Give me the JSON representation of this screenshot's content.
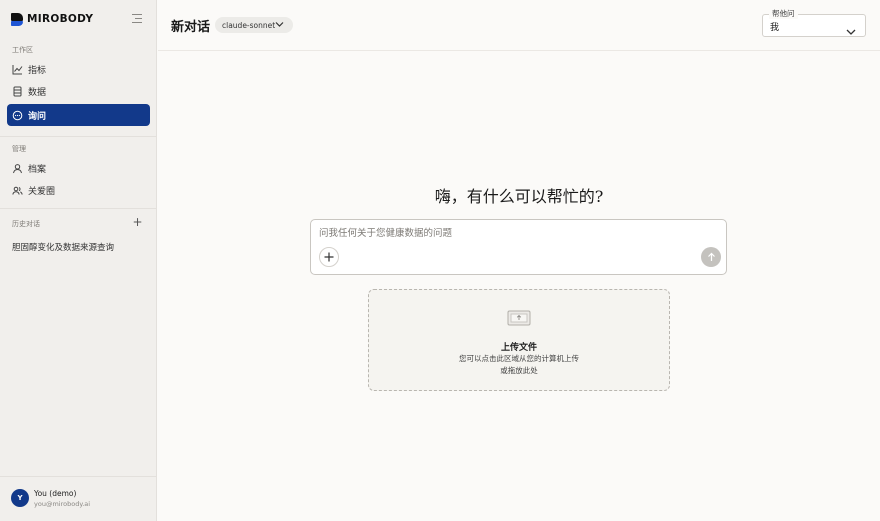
{
  "brand": {
    "name": "MIROBODY"
  },
  "sidebar": {
    "workspace_label": "工作区",
    "workspace_items": [
      {
        "label": "指标",
        "icon": "chart-line-icon"
      },
      {
        "label": "数据",
        "icon": "database-icon"
      },
      {
        "label": "询问",
        "icon": "chat-bubble-icon",
        "active": true
      }
    ],
    "manage_label": "管理",
    "manage_items": [
      {
        "label": "档案",
        "icon": "user-icon"
      },
      {
        "label": "关爱圈",
        "icon": "users-icon"
      }
    ],
    "history_label": "历史对话",
    "history_items": [
      "胆固醇变化及数据来源查询"
    ]
  },
  "user": {
    "initial": "Y",
    "name": "You (demo)",
    "email": "you@mirobody.ai"
  },
  "header": {
    "title": "新对话",
    "model": "claude-sonnet",
    "help_legend": "帮他问",
    "help_value": "我"
  },
  "main": {
    "greeting": "嗨，有什么可以帮忙的?",
    "input_placeholder": "问我任何关于您健康数据的问题",
    "upload_title": "上传文件",
    "upload_desc_line1": "您可以点击此区域从您的计算机上传",
    "upload_desc_line2": "或拖放此处"
  },
  "colors": {
    "accent": "#12398a",
    "brand_blue": "#1f55d4",
    "send_disabled": "#c4c2be"
  }
}
